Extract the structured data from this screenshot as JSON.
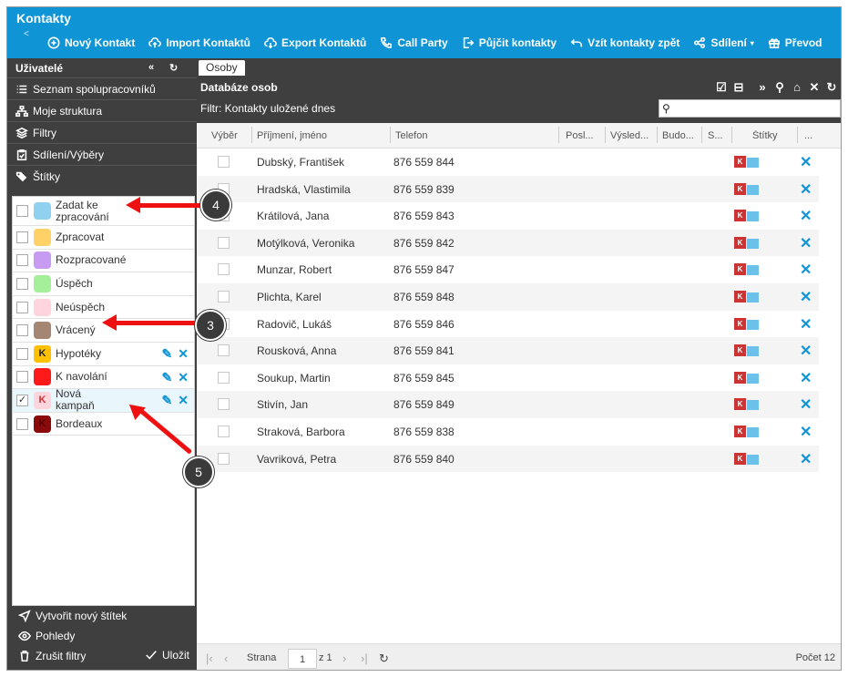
{
  "app": {
    "title": "Kontakty",
    "back_glyph": "<"
  },
  "toolbar": [
    {
      "id": "new-contact",
      "label": "Nový Kontakt",
      "icon": "plus-circle-icon"
    },
    {
      "id": "import",
      "label": "Import Kontaktů",
      "icon": "cloud-upload-icon"
    },
    {
      "id": "export",
      "label": "Export Kontaktů",
      "icon": "cloud-download-icon"
    },
    {
      "id": "call-party",
      "label": "Call Party",
      "icon": "phone-icon"
    },
    {
      "id": "lend",
      "label": "Půjčit kontakty",
      "icon": "exit-icon"
    },
    {
      "id": "take-back",
      "label": "Vzít kontakty zpět",
      "icon": "undo-arrow-icon"
    },
    {
      "id": "share",
      "label": "Sdílení",
      "icon": "share-icon",
      "caret": "▾"
    },
    {
      "id": "transfer",
      "label": "Převod",
      "icon": "gift-icon"
    }
  ],
  "sidebar": {
    "header": "Uživatelé",
    "header_icons": [
      "collapse-left-icon",
      "refresh-icon"
    ],
    "nav": [
      {
        "label": "Seznam spolupracovníků",
        "icon": "list-icon"
      },
      {
        "label": "Moje struktura",
        "icon": "hierarchy-icon"
      },
      {
        "label": "Filtry",
        "icon": "layers-icon"
      },
      {
        "label": "Sdílení/Výběry",
        "icon": "clipboard-check-icon"
      },
      {
        "label": "Štítky",
        "icon": "tags-icon"
      }
    ],
    "tags": [
      {
        "label": "Zadat ke zpracování",
        "color": "#8fd1ee",
        "letter": "",
        "checked": false,
        "editable": false
      },
      {
        "label": "Zpracovat",
        "color": "#ffd166",
        "letter": "",
        "checked": false,
        "editable": false
      },
      {
        "label": "Rozpracované",
        "color": "#c79bf2",
        "letter": "",
        "checked": false,
        "editable": false
      },
      {
        "label": "Úspěch",
        "color": "#a6ef9a",
        "letter": "",
        "checked": false,
        "editable": false
      },
      {
        "label": "Neúspěch",
        "color": "#ffd4dc",
        "letter": "",
        "checked": false,
        "editable": false
      },
      {
        "label": "Vrácený",
        "color": "#a58672",
        "letter": "",
        "checked": false,
        "editable": false
      },
      {
        "label": "Hypotéky",
        "color": "#ffc000",
        "letter": "K",
        "checked": false,
        "editable": true
      },
      {
        "label": "K navolání",
        "color": "#ff1a1a",
        "letter": "",
        "checked": false,
        "editable": true
      },
      {
        "label": "Nová kampaň",
        "color": "#ffd4dc",
        "letter": "K",
        "checked": true,
        "editable": true,
        "letter_color": "#c33"
      },
      {
        "label": "Bordeaux",
        "color": "#8b0a0a",
        "letter": "K",
        "checked": false,
        "editable": false,
        "letter_color": "#5a0000"
      }
    ],
    "footer": {
      "create_tag": "Vytvořit nový štítek",
      "views": "Pohledy",
      "clear_filters": "Zrušit filtry",
      "apply": "Uložit"
    }
  },
  "main": {
    "tab": "Osoby",
    "db_title": "Databáze osob",
    "filter_label": "Filtr: Kontakty uložené dnes",
    "search_value": "",
    "columns": [
      "Výběr",
      "Příjmení, jméno",
      "Telefon",
      "Posl...",
      "Výsled...",
      "Budo...",
      "S...",
      "Štítky",
      "..."
    ],
    "rows": [
      {
        "name": "Dubský, František",
        "phone": "876 559 844"
      },
      {
        "name": "Hradská, Vlastimila",
        "phone": "876 559 839"
      },
      {
        "name": "Krátilová, Jana",
        "phone": "876 559 843"
      },
      {
        "name": "Motýlková, Veronika",
        "phone": "876 559 842"
      },
      {
        "name": "Munzar, Robert",
        "phone": "876 559 847"
      },
      {
        "name": "Plichta, Karel",
        "phone": "876 559 848"
      },
      {
        "name": "Radovič, Lukáš",
        "phone": "876 559 846"
      },
      {
        "name": "Rousková, Anna",
        "phone": "876 559 841"
      },
      {
        "name": "Soukup, Martin",
        "phone": "876 559 845"
      },
      {
        "name": "Stivín, Jan",
        "phone": "876 559 849"
      },
      {
        "name": "Straková, Barbora",
        "phone": "876 559 838"
      },
      {
        "name": "Vavriková, Petra",
        "phone": "876 559 840"
      }
    ],
    "row_tag_letter": "K",
    "pager": {
      "page_label": "Strana",
      "page": "1",
      "of": "z 1",
      "count": "Počet 12"
    }
  },
  "annotations": [
    {
      "number": "4"
    },
    {
      "number": "3"
    },
    {
      "number": "5"
    }
  ],
  "colors": {
    "header": "#0f95d6",
    "sidebar": "#3f3f3f",
    "accent": "#0f95d6",
    "arrow": "#ee1111"
  }
}
